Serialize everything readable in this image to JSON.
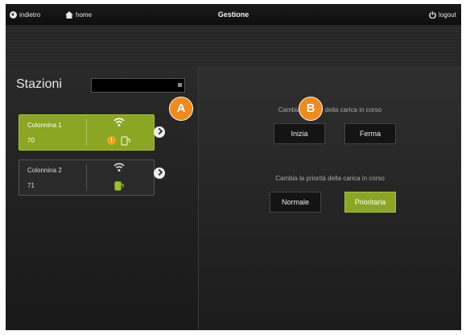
{
  "topbar": {
    "back_label": "indietro",
    "home_label": "home",
    "title": "Gestione",
    "logout_label": "logout"
  },
  "stations_panel": {
    "title": "Stazioni",
    "selector_value": "",
    "stations": [
      {
        "name": "Colonnina 1",
        "number": "70",
        "selected": true,
        "warning_badge": "!"
      },
      {
        "name": "Colonnina 2",
        "number": "71",
        "selected": false
      }
    ]
  },
  "charge_panel": {
    "state_label": "Cambia lo stato della carica in corso",
    "state_buttons": {
      "start": "Inizia",
      "stop": "Ferma"
    },
    "priority_label": "Cambia la priorità della carica in corso",
    "priority_buttons": {
      "normal": "Normale",
      "priority": "Prioritaria"
    },
    "active_priority": "Prioritaria"
  },
  "markers": {
    "a": "A",
    "b": "B"
  },
  "colors": {
    "accent_green": "#8aa623",
    "marker_orange": "#f08a1c",
    "warning_orange": "#f0a321",
    "background": "#1e1e1e"
  },
  "icons": {
    "back": "circle-back-arrow-icon",
    "home": "house-icon",
    "logout": "power-icon",
    "signal": "wifi-icon",
    "plug": "fuel-plug-icon",
    "next": "chevron-right-circle-icon"
  }
}
